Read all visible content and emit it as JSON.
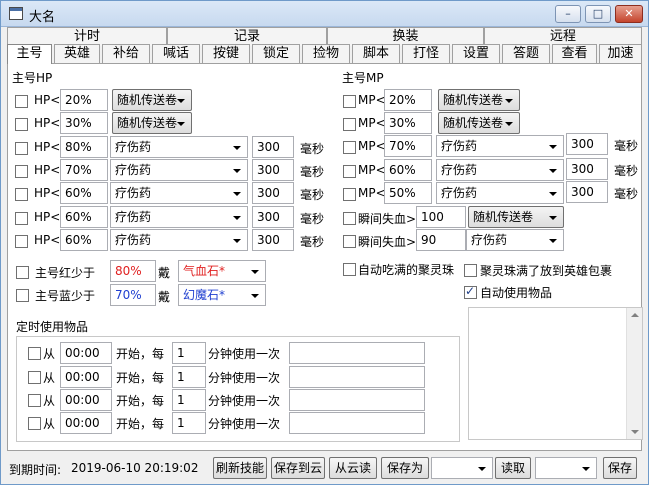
{
  "window": {
    "title": "大名",
    "minimize_glyph": "–",
    "maximize_glyph": "□",
    "close_glyph": "✕"
  },
  "top_tabs": [
    "计时",
    "记录",
    "换装",
    "远程"
  ],
  "sub_tabs": [
    "主号",
    "英雄",
    "补给",
    "喊话",
    "按键",
    "锁定",
    "捡物",
    "脚本",
    "打怪",
    "设置",
    "答题",
    "查看",
    "加速"
  ],
  "hp_section": {
    "title": "主号HP",
    "rows": [
      {
        "label": "HP<",
        "value": "20%",
        "item": "随机传送卷",
        "style": "scroll"
      },
      {
        "label": "HP<",
        "value": "30%",
        "item": "随机传送卷",
        "style": "scroll"
      },
      {
        "label": "HP<",
        "value": "80%",
        "item": "疗伤药",
        "ms": "300",
        "unit": "毫秒"
      },
      {
        "label": "HP<",
        "value": "70%",
        "item": "疗伤药",
        "ms": "300",
        "unit": "毫秒"
      },
      {
        "label": "HP<",
        "value": "60%",
        "item": "疗伤药",
        "ms": "300",
        "unit": "毫秒"
      },
      {
        "label": "HP<",
        "value": "60%",
        "item": "疗伤药",
        "ms": "300",
        "unit": "毫秒"
      },
      {
        "label": "HP<",
        "value": "60%",
        "item": "疗伤药",
        "ms": "300",
        "unit": "毫秒"
      }
    ]
  },
  "mp_section": {
    "title": "主号MP",
    "rows": [
      {
        "label": "MP<",
        "value": "20%",
        "item": "随机传送卷",
        "style": "scroll"
      },
      {
        "label": "MP<",
        "value": "30%",
        "item": "随机传送卷",
        "style": "scroll"
      },
      {
        "label": "MP<",
        "value": "70%",
        "item": "疗伤药",
        "ms": "300",
        "unit": "毫秒"
      },
      {
        "label": "MP<",
        "value": "60%",
        "item": "疗伤药",
        "ms": "300",
        "unit": "毫秒"
      },
      {
        "label": "MP<",
        "value": "50%",
        "item": "疗伤药",
        "ms": "300",
        "unit": "毫秒"
      }
    ],
    "instant": [
      {
        "label": "瞬间失血>",
        "value": "100",
        "item": "随机传送卷",
        "style": "scroll"
      },
      {
        "label": "瞬间失血>",
        "value": "90",
        "item": "疗伤药"
      }
    ]
  },
  "red_blue": [
    {
      "label": "主号红少于",
      "value": "80%",
      "wear": "戴",
      "item": "气血石*"
    },
    {
      "label": "主号蓝少于",
      "value": "70%",
      "wear": "戴",
      "item": "幻魔石*"
    }
  ],
  "checks": {
    "auto_eat": "自动吃满的聚灵珠",
    "spirit_full": "聚灵珠满了放到英雄包裹",
    "auto_use": "自动使用物品"
  },
  "timed": {
    "title": "定时使用物品",
    "rows": [
      {
        "from": "从",
        "time": "00:00",
        "start": "开始，每",
        "n": "1",
        "suffix": "分钟使用一次",
        "item": ""
      },
      {
        "from": "从",
        "time": "00:00",
        "start": "开始，每",
        "n": "1",
        "suffix": "分钟使用一次",
        "item": ""
      },
      {
        "from": "从",
        "time": "00:00",
        "start": "开始，每",
        "n": "1",
        "suffix": "分钟使用一次",
        "item": ""
      },
      {
        "from": "从",
        "time": "00:00",
        "start": "开始，每",
        "n": "1",
        "suffix": "分钟使用一次",
        "item": ""
      }
    ]
  },
  "footer": {
    "expiry_label": "到期时间:",
    "expiry_value": "2019-06-10 20:19:02",
    "refresh": "刷新技能",
    "save_cloud": "保存到云",
    "from_cloud": "从云读",
    "save_as": "保存为",
    "read": "读取",
    "save": "保存"
  }
}
